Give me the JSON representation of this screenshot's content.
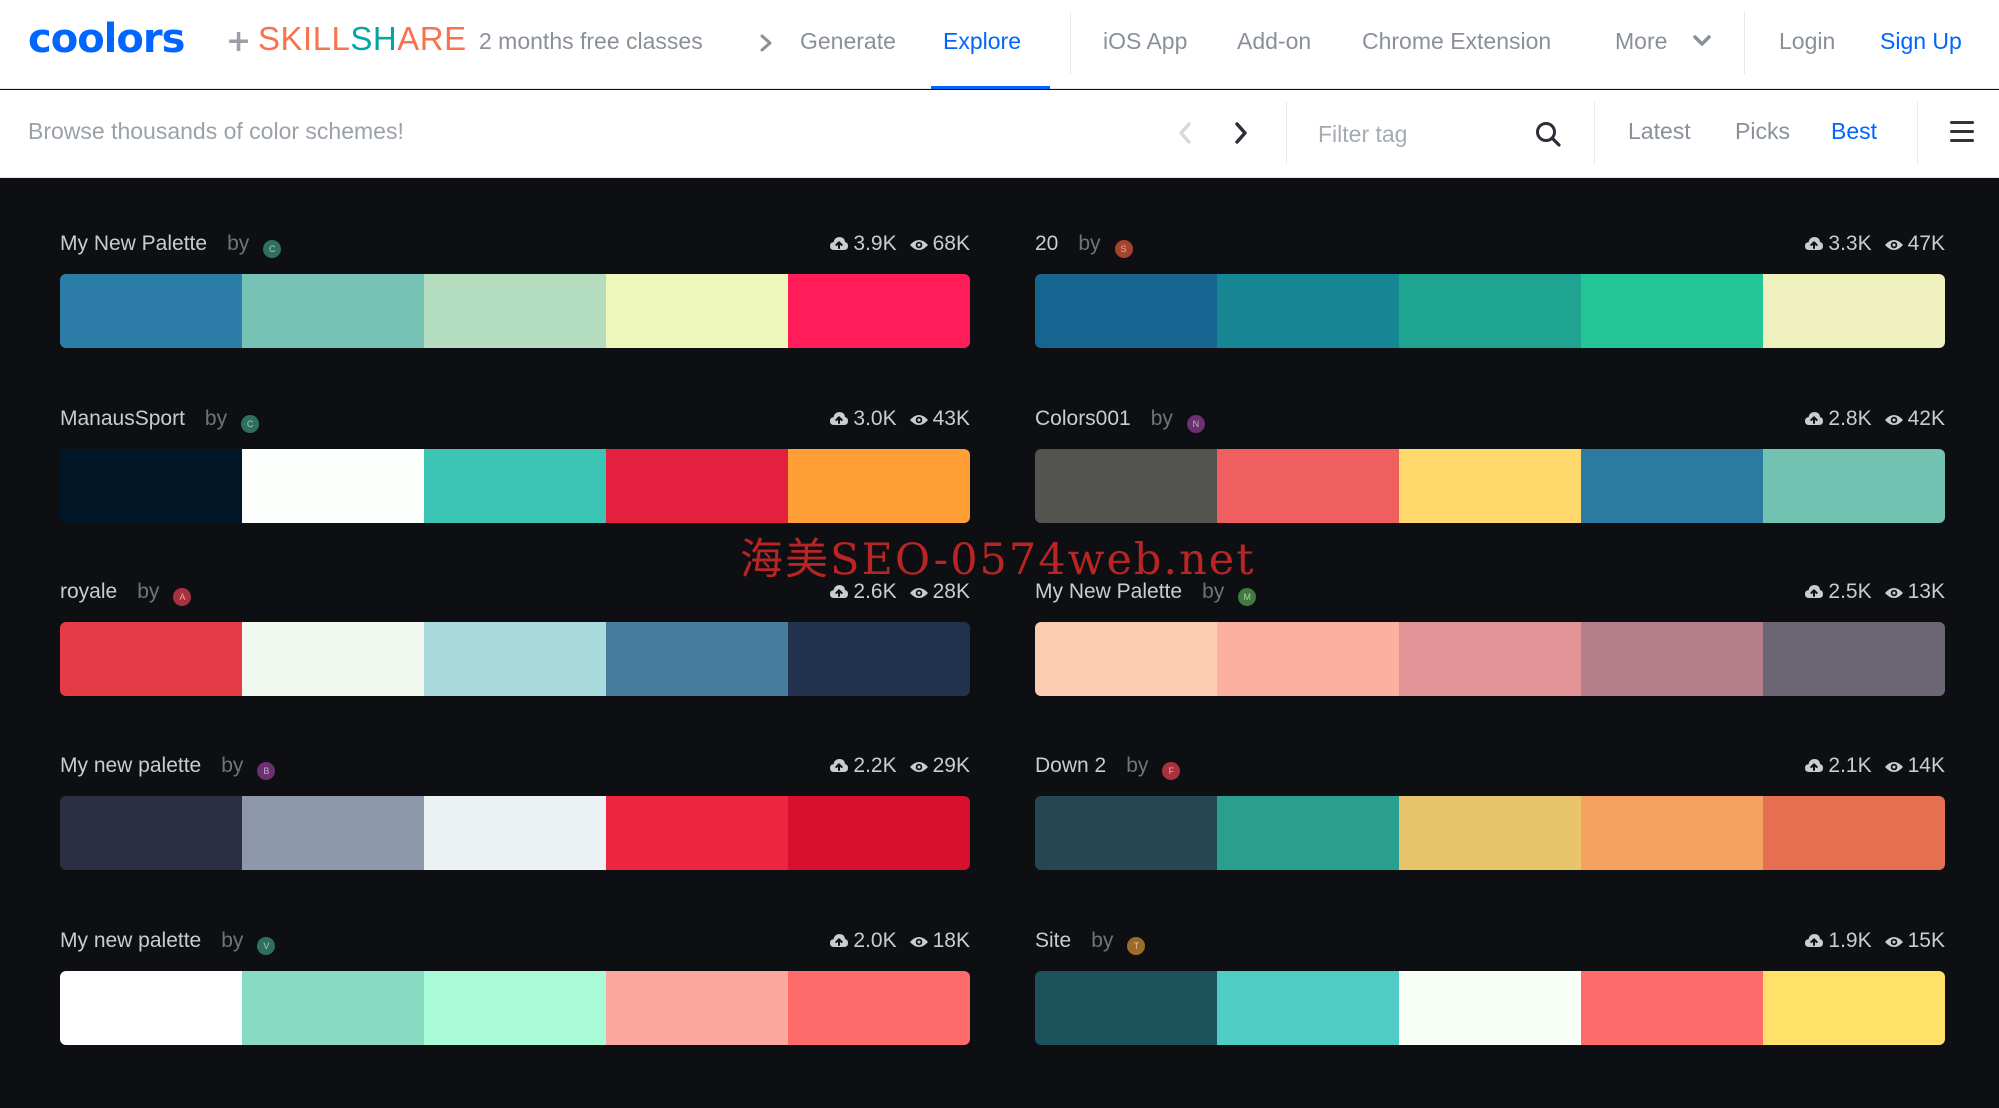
{
  "header": {
    "logo": "coolors",
    "plus": "+",
    "partner": {
      "part1": "SKILL",
      "part2": "SH",
      "part3": "ARE"
    },
    "promo": "2 months free classes",
    "nav": {
      "generate": "Generate",
      "explore": "Explore",
      "ios_app": "iOS App",
      "addon": "Add-on",
      "chrome": "Chrome Extension",
      "more": "More",
      "login": "Login",
      "signup": "Sign Up"
    },
    "active_item": "Explore",
    "accent_color": "#0066ff"
  },
  "subbar": {
    "browse_text": "Browse thousands of color schemes!",
    "filter_placeholder": "Filter tag",
    "sort": {
      "latest": "Latest",
      "picks": "Picks",
      "best": "Best"
    },
    "active_sort": "Best"
  },
  "palettes": [
    {
      "name": "My New Palette",
      "by": "by",
      "avatar_letter": "C",
      "avatar_color": "#2f6f5e",
      "saves": "3.9K",
      "views": "68K",
      "colors": [
        "#2c7ea8",
        "#76c3b5",
        "#b4ddc0",
        "#eff8bb",
        "#ff1c58"
      ]
    },
    {
      "name": "20",
      "by": "by",
      "avatar_letter": "S",
      "avatar_color": "#a4432e",
      "saves": "3.3K",
      "views": "47K",
      "colors": [
        "#166490",
        "#168594",
        "#1ea491",
        "#24c596",
        "#eef0bd"
      ]
    },
    {
      "name": "ManausSport",
      "by": "by",
      "avatar_letter": "C",
      "avatar_color": "#2f6f5e",
      "saves": "3.0K",
      "views": "43K",
      "colors": [
        "#011627",
        "#fdfffc",
        "#3cc4b4",
        "#e42040",
        "#ff9f35"
      ]
    },
    {
      "name": "Colors001",
      "by": "by",
      "avatar_letter": "N",
      "avatar_color": "#6a3072",
      "saves": "2.8K",
      "views": "42K",
      "colors": [
        "#535350",
        "#ef5f5f",
        "#ffd96c",
        "#2b7ba1",
        "#72c3b2"
      ]
    },
    {
      "name": "royale",
      "by": "by",
      "avatar_letter": "A",
      "avatar_color": "#a8313d",
      "saves": "2.6K",
      "views": "28K",
      "colors": [
        "#e63a47",
        "#f1f9ee",
        "#a9dade",
        "#467c9d",
        "#21324e"
      ]
    },
    {
      "name": "My New Palette",
      "by": "by",
      "avatar_letter": "M",
      "avatar_color": "#3f7a3f",
      "saves": "2.5K",
      "views": "13K",
      "colors": [
        "#fdcbaf",
        "#fdafa0",
        "#e29395",
        "#b47f8a",
        "#6c6674"
      ]
    },
    {
      "name": "My new palette",
      "by": "by",
      "avatar_letter": "B",
      "avatar_color": "#6a3072",
      "saves": "2.2K",
      "views": "29K",
      "colors": [
        "#2c2e44",
        "#8d99ab",
        "#ecf2f4",
        "#ec2641",
        "#d80f2e"
      ]
    },
    {
      "name": "Down 2",
      "by": "by",
      "avatar_letter": "F",
      "avatar_color": "#a8313d",
      "saves": "2.1K",
      "views": "14K",
      "colors": [
        "#264653",
        "#2a9e8f",
        "#e8c46b",
        "#f3a261",
        "#e76f51"
      ]
    },
    {
      "name": "My new palette",
      "by": "by",
      "avatar_letter": "V",
      "avatar_color": "#2f6f5e",
      "saves": "2.0K",
      "views": "18K",
      "colors": [
        "#ffffff",
        "#88dbc3",
        "#a9fbd7",
        "#fca79e",
        "#ff6b6b"
      ]
    },
    {
      "name": "Site",
      "by": "by",
      "avatar_letter": "T",
      "avatar_color": "#9e6a2a",
      "saves": "1.9K",
      "views": "15K",
      "colors": [
        "#1b535c",
        "#4fccc4",
        "#f7fff7",
        "#ff6b6b",
        "#ffe069"
      ]
    }
  ],
  "watermark": "海美SEO-0574web.net"
}
